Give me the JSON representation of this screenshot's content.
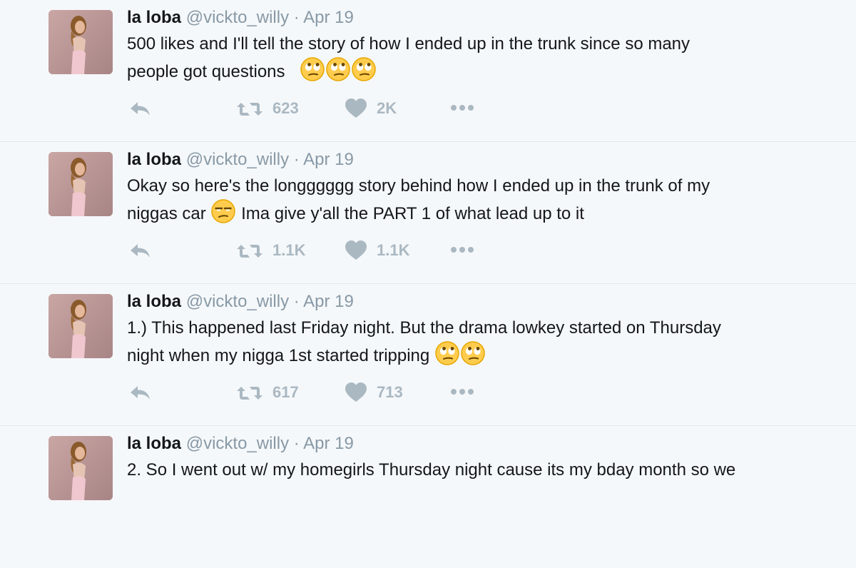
{
  "tweets": [
    {
      "name": "la loba",
      "handle": "@vickto_willy",
      "separator": "·",
      "date": "Apr 19",
      "text_line1": "500 likes and I'll tell the story of how I ended up in the trunk since so many",
      "text_line2": "people got questions",
      "retweets": "623",
      "likes": "2K"
    },
    {
      "name": "la loba",
      "handle": "@vickto_willy",
      "separator": "·",
      "date": "Apr 19",
      "text_line1": "Okay so here's the longggggg story behind how I ended up in the trunk of my",
      "text_line2a": "niggas car",
      "text_line2b": "Ima give y'all the PART 1 of what lead up to it",
      "retweets": "1.1K",
      "likes": "1.1K"
    },
    {
      "name": "la loba",
      "handle": "@vickto_willy",
      "separator": "·",
      "date": "Apr 19",
      "text_line1": "1.) This happened last Friday night. But the drama lowkey started  on Thursday",
      "text_line2": "night when my nigga 1st started tripping",
      "retweets": "617",
      "likes": "713"
    },
    {
      "name": "la loba",
      "handle": "@vickto_willy",
      "separator": "·",
      "date": "Apr 19",
      "text_line1": "2. So I went out w/ my homegirls Thursday night cause its my bday month so we"
    }
  ],
  "icons": {
    "reply": "reply-icon",
    "retweet": "retweet-icon",
    "like": "heart-icon",
    "more": "more-icon",
    "emoji_eyeroll": "face-with-rolling-eyes-emoji",
    "emoji_unamused": "unamused-face-emoji"
  },
  "colors": {
    "background": "#f5f8fa",
    "name": "#14171a",
    "meta": "#8899a6",
    "action": "#aab8c2",
    "divider": "#e1e8ed",
    "emoji": "#ffcc4d"
  }
}
